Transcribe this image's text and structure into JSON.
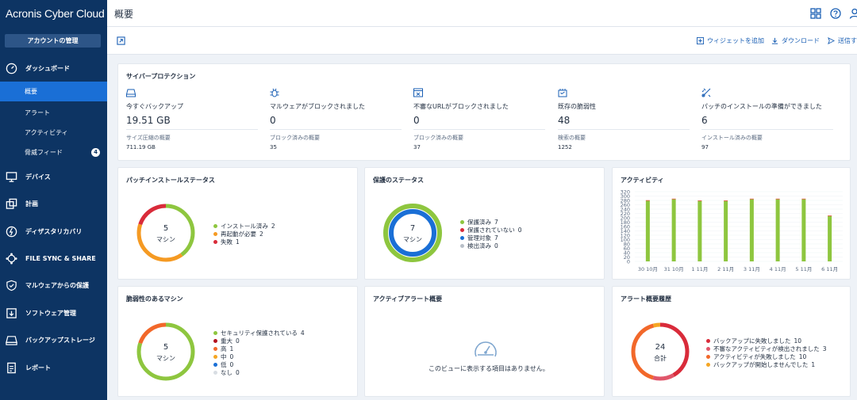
{
  "app": {
    "logo_text": "Acronis Cyber Cloud",
    "account_button": "アカウントの管理"
  },
  "sidebar": {
    "dashboard": "ダッシュボード",
    "sub_items": [
      {
        "label": "概要",
        "active": true
      },
      {
        "label": "アラート"
      },
      {
        "label": "アクティビティ"
      },
      {
        "label": "脅威フィード",
        "badge": "4"
      }
    ],
    "items": [
      {
        "label": "デバイス",
        "icon": "monitor-icon"
      },
      {
        "label": "計画",
        "icon": "plans-icon"
      },
      {
        "label": "ディザスタリカバリ",
        "icon": "disaster-recovery-icon"
      },
      {
        "label": "FILE SYNC & SHARE",
        "icon": "file-sync-icon"
      },
      {
        "label": "マルウェアからの保護",
        "icon": "shield-icon"
      },
      {
        "label": "ソフトウェア管理",
        "icon": "software-icon"
      },
      {
        "label": "バックアップストレージ",
        "icon": "storage-icon"
      },
      {
        "label": "レポート",
        "icon": "report-icon"
      }
    ]
  },
  "header": {
    "title": "概要"
  },
  "toolbar": {
    "add_widget": "ウィジェットを追加",
    "download": "ダウンロード",
    "send": "送信す"
  },
  "cyber": {
    "title": "サイバープロテクション",
    "stats": [
      {
        "label": "今すぐバックアップ",
        "value": "19.51 GB",
        "sub": "サイズ圧縮の概要",
        "subval": "711.19 GB",
        "icon": "backup-drive-icon"
      },
      {
        "label": "マルウェアがブロックされました",
        "value": "0",
        "sub": "ブロック済みの概要",
        "subval": "35",
        "icon": "bug-icon"
      },
      {
        "label": "不審なURLがブロックされました",
        "value": "0",
        "sub": "ブロック済みの概要",
        "subval": "37",
        "icon": "url-block-icon"
      },
      {
        "label": "既存の脆弱性",
        "value": "48",
        "sub": "検索の概要",
        "subval": "1252",
        "icon": "vulnerability-icon"
      },
      {
        "label": "パッチのインストールの準備ができました",
        "value": "6",
        "sub": "インストール済みの概要",
        "subval": "97",
        "icon": "patch-icon"
      }
    ]
  },
  "patch_status": {
    "title": "パッチインストールステータス",
    "center_num": "5",
    "center_label": "マシン",
    "legend": [
      {
        "label": "インストール済み",
        "count": "2",
        "color": "#8ec63f"
      },
      {
        "label": "再起動が必要",
        "count": "2",
        "color": "#f59a23"
      },
      {
        "label": "失敗",
        "count": "1",
        "color": "#d92b3a"
      }
    ]
  },
  "protection_status": {
    "title": "保護のステータス",
    "center_num": "7",
    "center_label": "マシン",
    "legend": [
      {
        "label": "保護済み",
        "count": "7",
        "color": "#8ec63f"
      },
      {
        "label": "保護されていない",
        "count": "0",
        "color": "#d92b3a"
      },
      {
        "label": "管理対象",
        "count": "7",
        "color": "#1a6fd6"
      },
      {
        "label": "検出済み",
        "count": "0",
        "color": "#b8bfc8"
      }
    ]
  },
  "activities": {
    "title": "アクティビティ",
    "chart_data": {
      "type": "bar",
      "categories": [
        "30 10月",
        "31 10月",
        "1 11月",
        "2 11月",
        "3 11月",
        "4 11月",
        "5 11月",
        "6 11月"
      ],
      "series": [
        {
          "values": [
            278,
            285,
            277,
            277,
            285,
            285,
            285,
            208
          ],
          "color": "#8ec63f"
        },
        {
          "values": [
            3,
            3,
            3,
            3,
            3,
            3,
            3,
            3
          ],
          "color": "#e0523a"
        }
      ],
      "yticks": [
        "0",
        "20",
        "40",
        "60",
        "80",
        "100",
        "120",
        "140",
        "160",
        "180",
        "200",
        "220",
        "240",
        "260",
        "280",
        "300",
        "320"
      ],
      "ylim": [
        0,
        320
      ]
    }
  },
  "vulnerable": {
    "title": "脆弱性のあるマシン",
    "center_num": "5",
    "center_label": "マシン",
    "legend": [
      {
        "label": "セキュリティ保護されている",
        "count": "4",
        "color": "#8ec63f"
      },
      {
        "label": "重大",
        "count": "0",
        "color": "#b3121f"
      },
      {
        "label": "高",
        "count": "1",
        "color": "#f2682a"
      },
      {
        "label": "中",
        "count": "0",
        "color": "#f5a623"
      },
      {
        "label": "低",
        "count": "0",
        "color": "#1a6fd6"
      },
      {
        "label": "なし",
        "count": "0",
        "color": "#d8dde3"
      }
    ]
  },
  "active_alerts": {
    "title": "アクティブアラート概要",
    "empty": "このビューに表示する項目はありません。"
  },
  "alert_history": {
    "title": "アラート概要履歴",
    "center_num": "24",
    "center_label": "合計",
    "legend": [
      {
        "label": "バックアップに失敗しました",
        "count": "10",
        "color": "#d92b3a"
      },
      {
        "label": "不審なアクティビティが検出されました",
        "count": "3",
        "color": "#e0566a"
      },
      {
        "label": "アクティビティが失敗しました",
        "count": "10",
        "color": "#f2682a"
      },
      {
        "label": "バックアップが開始しませんでした",
        "count": "1",
        "color": "#f5a623"
      }
    ]
  }
}
